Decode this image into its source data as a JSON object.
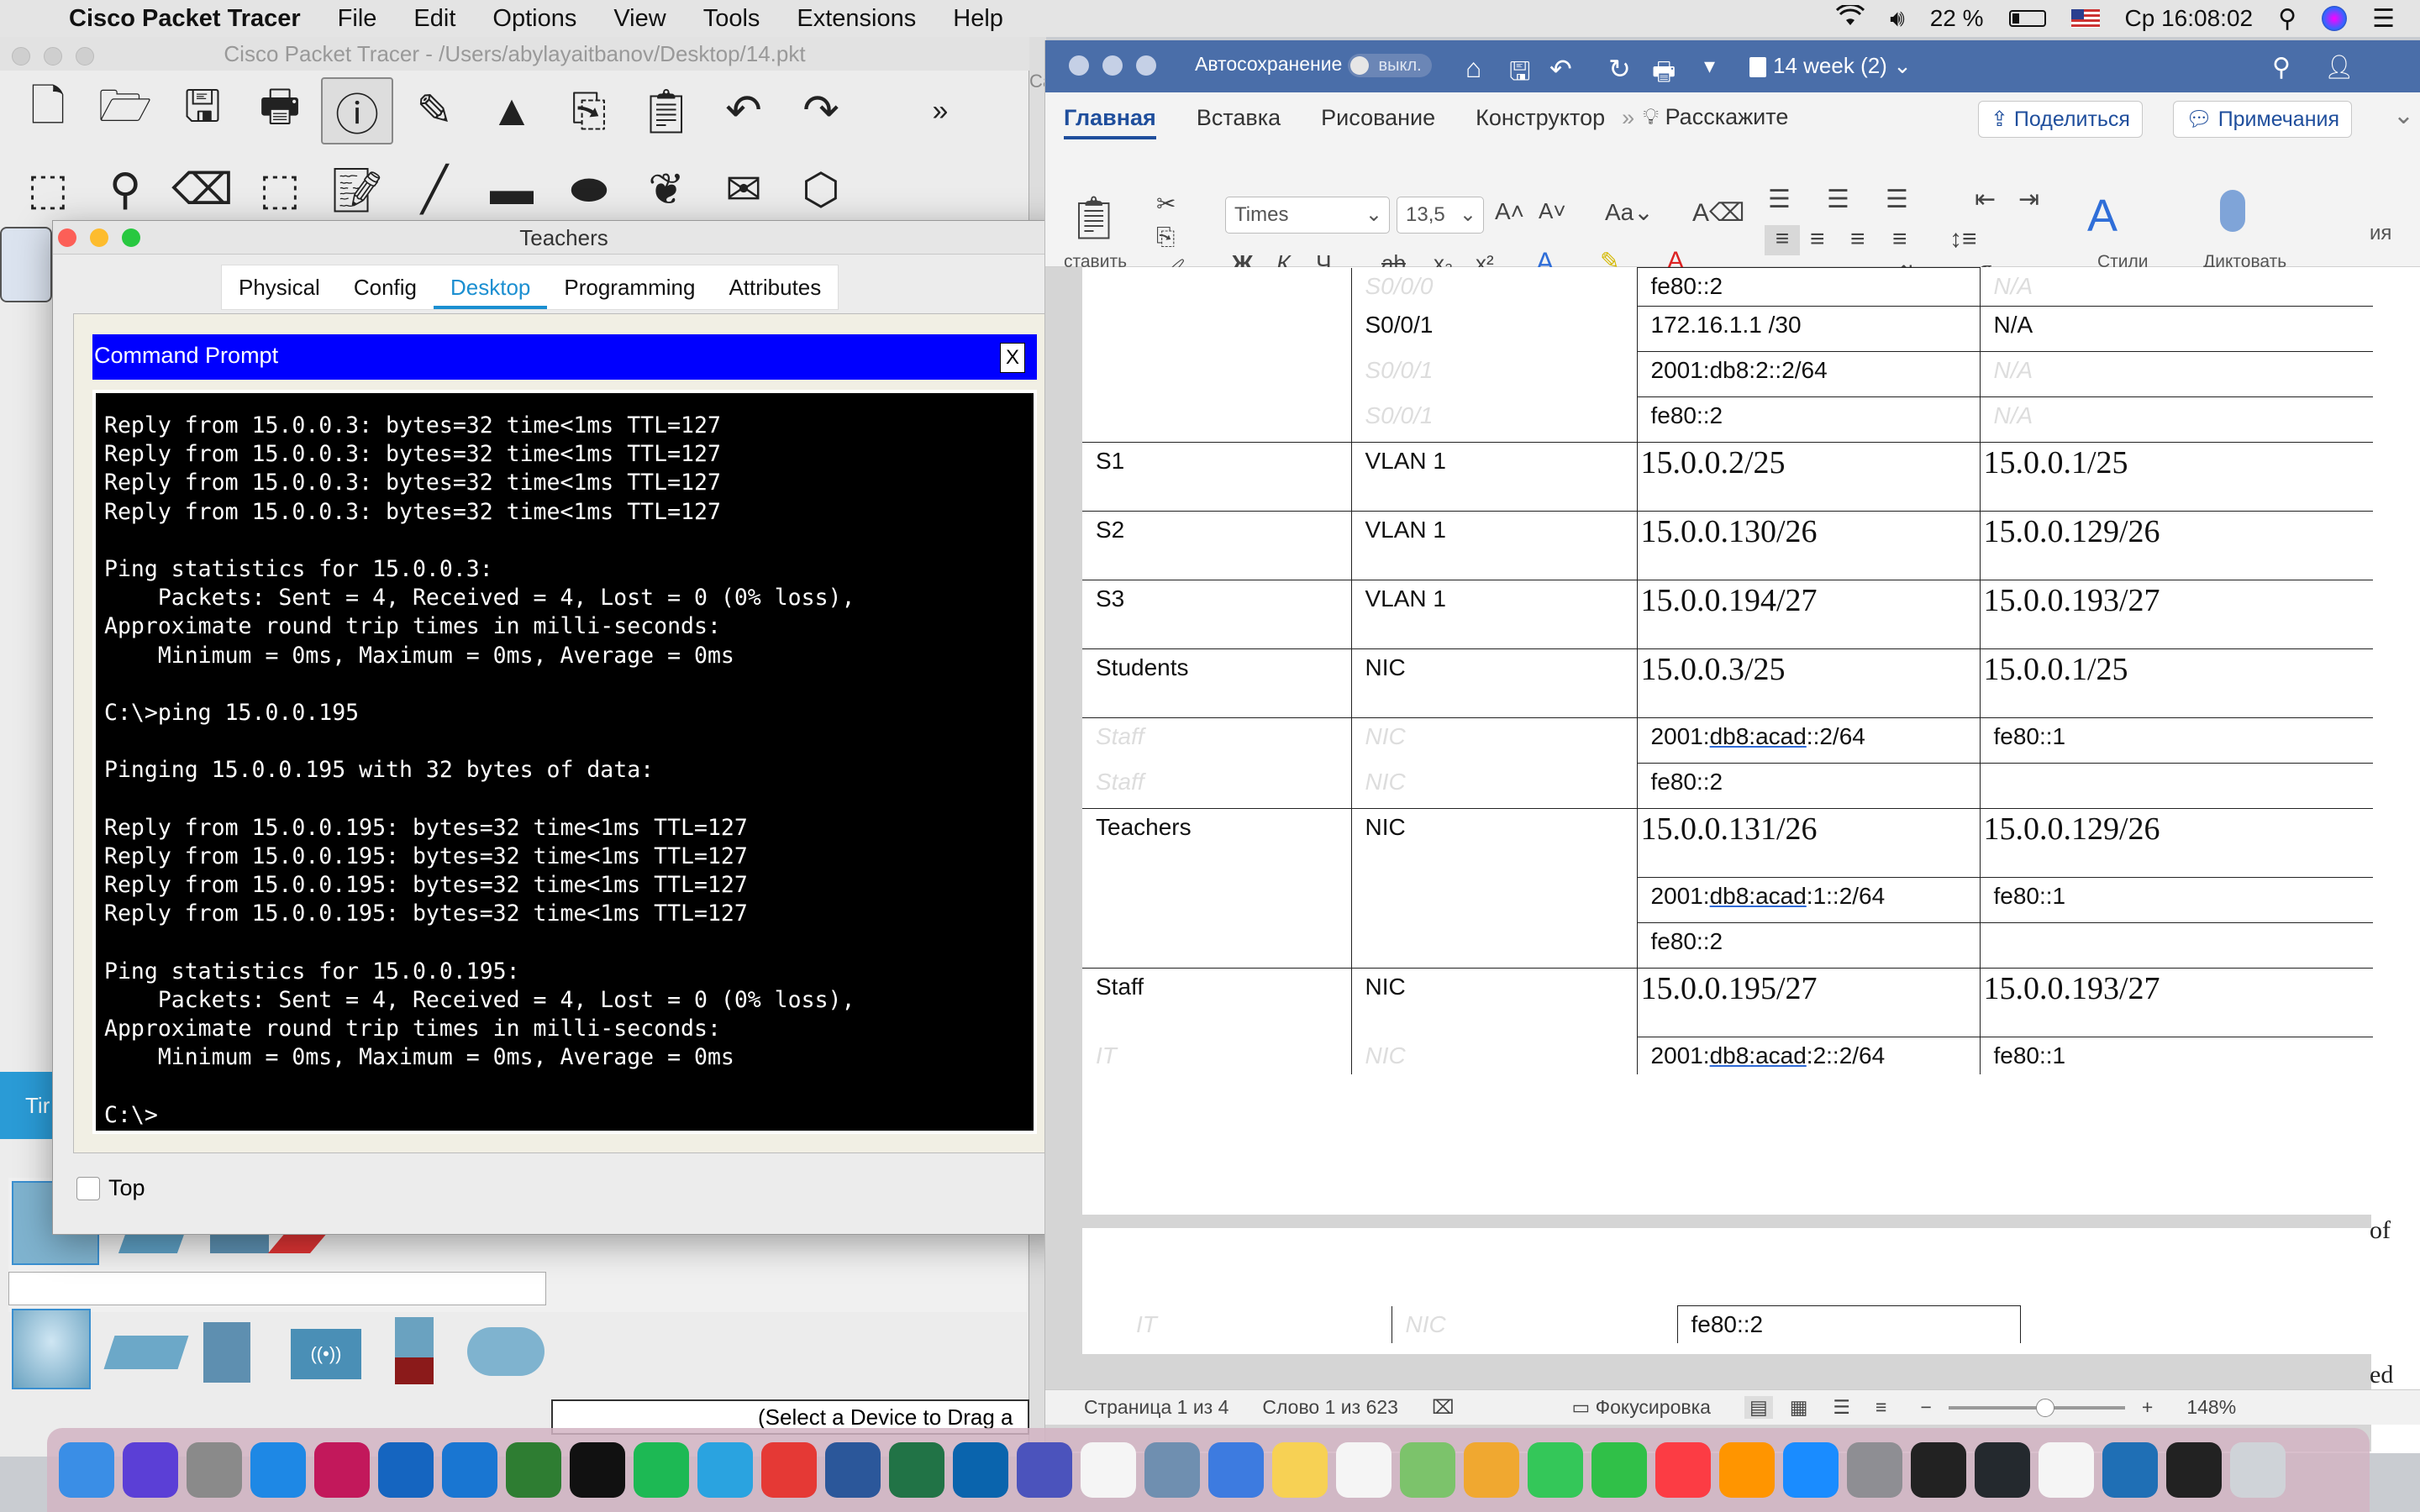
{
  "menubar": {
    "app": "Cisco Packet Tracer",
    "items": [
      "File",
      "Edit",
      "Options",
      "View",
      "Tools",
      "Extensions",
      "Help"
    ],
    "battery": "22 %",
    "clock": "Ср 16:08:02"
  },
  "pt": {
    "title": "Cisco Packet Tracer - /Users/abylayaitbanov/Desktop/14.pkt",
    "left_tab": "Tir",
    "drag_hint": "(Select a Device to Drag a",
    "ca_stub": "Ca"
  },
  "teachers": {
    "title": "Teachers",
    "tabs": [
      "Physical",
      "Config",
      "Desktop",
      "Programming",
      "Attributes"
    ],
    "active_tab": "Desktop",
    "cmd_title": "Command Prompt",
    "close_label": "X",
    "top_label": "Top",
    "terminal_lines": [
      "Reply from 15.0.0.3: bytes=32 time<1ms TTL=127",
      "Reply from 15.0.0.3: bytes=32 time<1ms TTL=127",
      "Reply from 15.0.0.3: bytes=32 time<1ms TTL=127",
      "Reply from 15.0.0.3: bytes=32 time<1ms TTL=127",
      "",
      "Ping statistics for 15.0.0.3:",
      "    Packets: Sent = 4, Received = 4, Lost = 0 (0% loss),",
      "Approximate round trip times in milli-seconds:",
      "    Minimum = 0ms, Maximum = 0ms, Average = 0ms",
      "",
      "C:\\>ping 15.0.0.195",
      "",
      "Pinging 15.0.0.195 with 32 bytes of data:",
      "",
      "Reply from 15.0.0.195: bytes=32 time<1ms TTL=127",
      "Reply from 15.0.0.195: bytes=32 time<1ms TTL=127",
      "Reply from 15.0.0.195: bytes=32 time<1ms TTL=127",
      "Reply from 15.0.0.195: bytes=32 time<1ms TTL=127",
      "",
      "Ping statistics for 15.0.0.195:",
      "    Packets: Sent = 4, Received = 4, Lost = 0 (0% loss),",
      "Approximate round trip times in milli-seconds:",
      "    Minimum = 0ms, Maximum = 0ms, Average = 0ms",
      "",
      "C:\\>"
    ]
  },
  "word": {
    "autosave": "Автосохранение",
    "autosave_state": "выкл.",
    "doc_title": "14 week (2)",
    "ribbon_tabs": [
      "Главная",
      "Вставка",
      "Рисование",
      "Конструктор"
    ],
    "tell_me": "Расскажите",
    "share": "Поделиться",
    "comments": "Примечания",
    "paste_label": "ставить",
    "font": "Times",
    "size": "13,5",
    "styles": "Стили",
    "dictate": "Диктовать",
    "side_label": "ия",
    "table": [
      {
        "c1": "",
        "c2": "S0/0/0",
        "c2g": true,
        "c3": "fe80::2",
        "c4": "N/A",
        "c4g": true
      },
      {
        "c1": "",
        "c2": "S0/0/1",
        "c3": "172.16.1.1 /30",
        "c4": "N/A"
      },
      {
        "c1": "",
        "c2": "S0/0/1",
        "c2g": true,
        "c3": "2001:db8:2::2/64",
        "c4": "N/A",
        "c4g": true
      },
      {
        "c1": "",
        "c2": "S0/0/1",
        "c2g": true,
        "c3": "fe80::2",
        "c4": "N/A",
        "c4g": true
      },
      {
        "c1": "S1",
        "c2": "VLAN 1",
        "c3": "15.0.0.2/25",
        "c4": "15.0.0.1/25"
      },
      {
        "c1": "S2",
        "c2": "VLAN 1",
        "c3": "15.0.0.130/26",
        "c4": "15.0.0.129/26"
      },
      {
        "c1": "S3",
        "c2": "VLAN 1",
        "c3": "15.0.0.194/27",
        "c4": "15.0.0.193/27"
      },
      {
        "c1": "Students",
        "c2": "NIC",
        "c3": "15.0.0.3/25",
        "c4": "15.0.0.1/25"
      },
      {
        "c1": "Staff",
        "c1g": true,
        "c2": "NIC",
        "c2g": true,
        "c3": "2001:db8:acad::2/64",
        "c4": "fe80::1"
      },
      {
        "c1": "Staff",
        "c1g": true,
        "c2": "NIC",
        "c2g": true,
        "c3": "fe80::2",
        "c4": ""
      },
      {
        "c1": "Teachers",
        "c2": "NIC",
        "c3": "15.0.0.131/26",
        "c4": "15.0.0.129/26"
      },
      {
        "c1": "",
        "c2": "",
        "c3": "2001:db8:acad:1::2/64",
        "c4": "fe80::1"
      },
      {
        "c1": "",
        "c2": "",
        "c3": "fe80::2",
        "c4": ""
      },
      {
        "c1": "Staff",
        "c2": "NIC",
        "c3": "15.0.0.195/27",
        "c4": "15.0.0.193/27"
      },
      {
        "c1": "IT",
        "c1g": true,
        "c2": "NIC",
        "c2g": true,
        "c3": "2001:db8:acad:2::2/64",
        "c4": "fe80::1"
      }
    ],
    "page2_row": {
      "c1": "IT",
      "c2": "NIC",
      "c3": "fe80::2"
    },
    "status": {
      "page": "Страница 1 из 4",
      "words": "Слово 1 из 623",
      "focus": "Фокусировка",
      "zoom": "148%"
    },
    "behind_text": [
      "of",
      "ed"
    ]
  },
  "dock_apps": [
    "Finder",
    "Siri",
    "Launchpad",
    "Safari",
    "PC",
    "Shark",
    "VS Code",
    "PyCharm",
    "WebStorm",
    "Spotify",
    "Telegram",
    "Chrome",
    "Word",
    "Excel",
    "Outlook",
    "Teams",
    "Calendar",
    "Preview",
    "Mail",
    "Notes",
    "Reminders",
    "Maps",
    "Photos",
    "Messages",
    "FaceTime",
    "Music",
    "Books",
    "App Store",
    "Settings",
    "Terminal",
    "GitHub",
    "Notion",
    "Packet Tracer",
    "Screen",
    "Trash"
  ]
}
